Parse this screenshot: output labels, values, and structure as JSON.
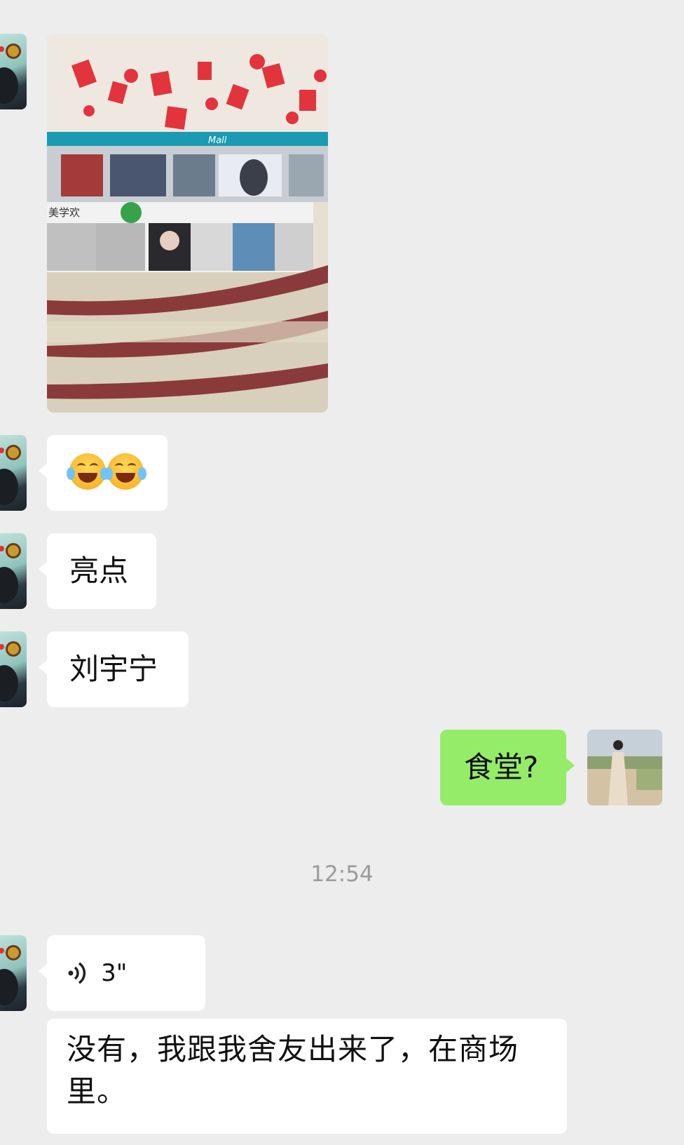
{
  "messages": [
    {
      "type": "image",
      "from": "other",
      "content": "mall-photo",
      "visible_text": [
        "美学欢",
        "Mall"
      ]
    },
    {
      "type": "emoji",
      "from": "other",
      "content": "😂😂"
    },
    {
      "type": "text",
      "from": "other",
      "content": "亮点"
    },
    {
      "type": "text",
      "from": "other",
      "content": "刘宇宁"
    },
    {
      "type": "text",
      "from": "self",
      "content": "食堂?"
    },
    {
      "type": "voice",
      "from": "other",
      "duration": "3\""
    },
    {
      "type": "text",
      "from": "other",
      "content": "没有，我跟我舍友出来了，在商场里。"
    }
  ],
  "timestamp": "12:54",
  "colors": {
    "background": "#ededed",
    "self_bubble": "#95ec69",
    "other_bubble": "#ffffff"
  },
  "icons": {
    "voice": "voice-wave-icon"
  }
}
